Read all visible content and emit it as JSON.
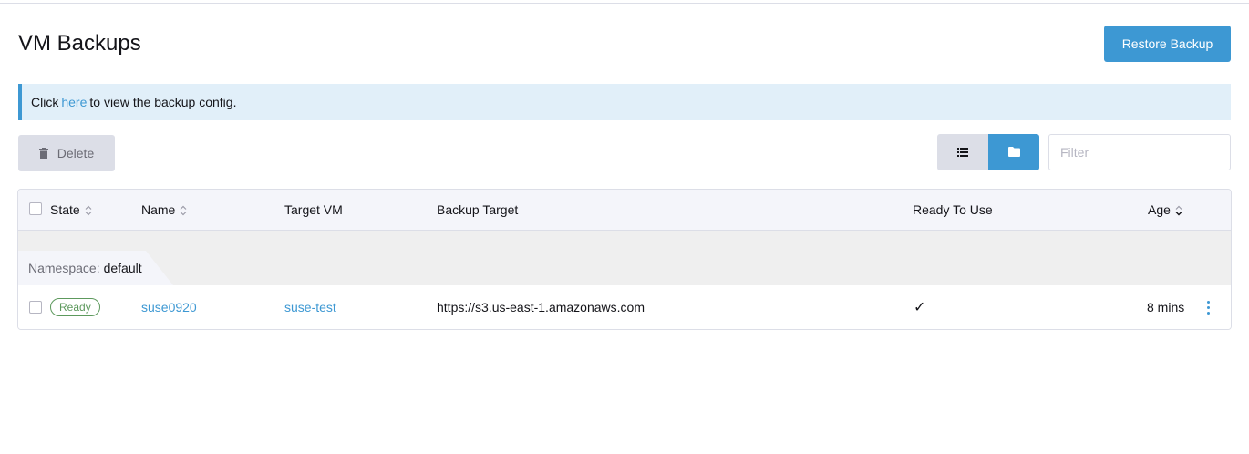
{
  "page": {
    "title": "VM Backups"
  },
  "actions": {
    "restore_label": "Restore Backup"
  },
  "banner": {
    "prefix": "Click",
    "link": "here",
    "suffix": "to view the backup config."
  },
  "toolbar": {
    "delete_label": "Delete",
    "filter_placeholder": "Filter"
  },
  "table": {
    "headers": {
      "state": "State",
      "name": "Name",
      "target_vm": "Target VM",
      "backup_target": "Backup Target",
      "ready": "Ready To Use",
      "age": "Age"
    },
    "group": {
      "label": "Namespace:",
      "value": "default"
    },
    "rows": [
      {
        "state": "Ready",
        "name": "suse0920",
        "target_vm": "suse-test",
        "backup_target": "https://s3.us-east-1.amazonaws.com",
        "ready": "✓",
        "age": "8 mins"
      }
    ]
  },
  "colors": {
    "accent": "#3d98d3",
    "ready": "#5d995d",
    "banner_bg": "#e1eff9"
  },
  "icons": [
    "trash-icon",
    "list-icon",
    "folder-icon",
    "sort-icon",
    "check-icon",
    "kebab-icon"
  ]
}
